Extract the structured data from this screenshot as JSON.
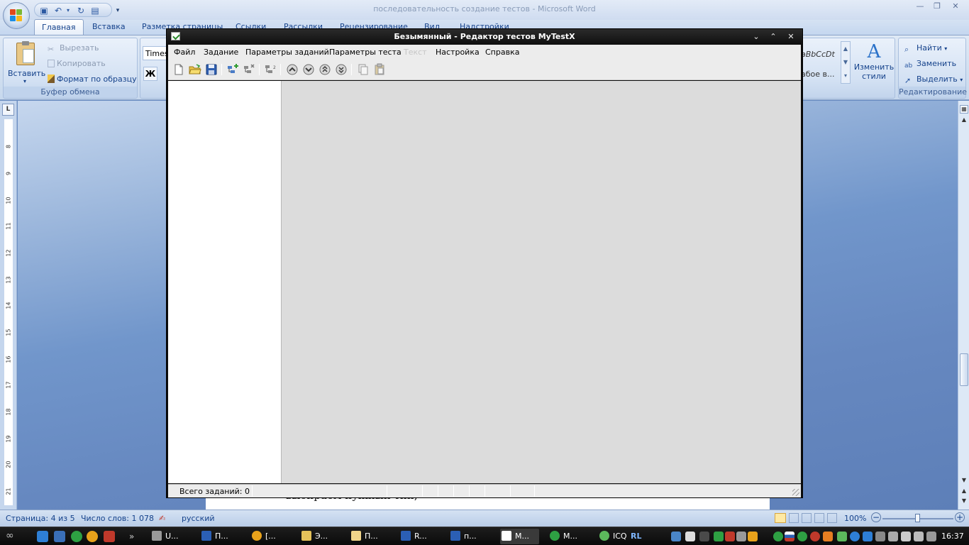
{
  "word": {
    "title": "последовательность создание тестов - Microsoft Word",
    "tabs": [
      "Главная",
      "Вставка",
      "Разметка страницы",
      "Ссылки",
      "Рассылки",
      "Рецензирование",
      "Вид",
      "Надстройки"
    ],
    "clipboard": {
      "paste": "Вставить",
      "cut": "Вырезать",
      "copy": "Копировать",
      "format_painter": "Формат по образцу",
      "group_label": "Буфер обмена"
    },
    "font": {
      "name": "Times",
      "bold": "Ж"
    },
    "styles": {
      "preview": "aBbCcDt",
      "normal": "абое в...",
      "change_styles": "Изменить",
      "change_styles_2": "стили"
    },
    "editing": {
      "find": "Найти",
      "replace": "Заменить",
      "select": "Выделить",
      "group_label": "Редактирование"
    },
    "ruler_numbers": [
      "8",
      "9",
      "10",
      "11",
      "12",
      "13",
      "14",
      "15",
      "16",
      "17",
      "18",
      "19",
      "20",
      "21",
      "22"
    ],
    "document_text": "выбираем нужный тип,",
    "status": {
      "page": "Страница: 4 из 5",
      "words": "Число слов: 1 078",
      "language": "русский",
      "zoom": "100%"
    }
  },
  "mytestx": {
    "title": "Безымянный - Редактор тестов MyTestX",
    "menu": [
      {
        "label": "Файл",
        "enabled": true
      },
      {
        "label": "Задание",
        "enabled": true
      },
      {
        "label": "Параметры заданий",
        "enabled": true
      },
      {
        "label": "Параметры теста",
        "enabled": true
      },
      {
        "label": "Текст",
        "enabled": false
      },
      {
        "label": "Настройка",
        "enabled": true
      },
      {
        "label": "Справка",
        "enabled": true
      }
    ],
    "status": {
      "total_tasks": "Всего заданий: 0"
    }
  },
  "taskbar": {
    "tasks": [
      "U...",
      "П...",
      "[...",
      "Э...",
      "П...",
      "R...",
      "п...",
      "M...",
      "M...",
      "ICQ"
    ],
    "language": "RL",
    "clock": "16:37"
  },
  "colors": {
    "word_accent": "#15428b",
    "mytestx_title_bg": "#101010",
    "workspace_gray": "#dcdcdc"
  }
}
